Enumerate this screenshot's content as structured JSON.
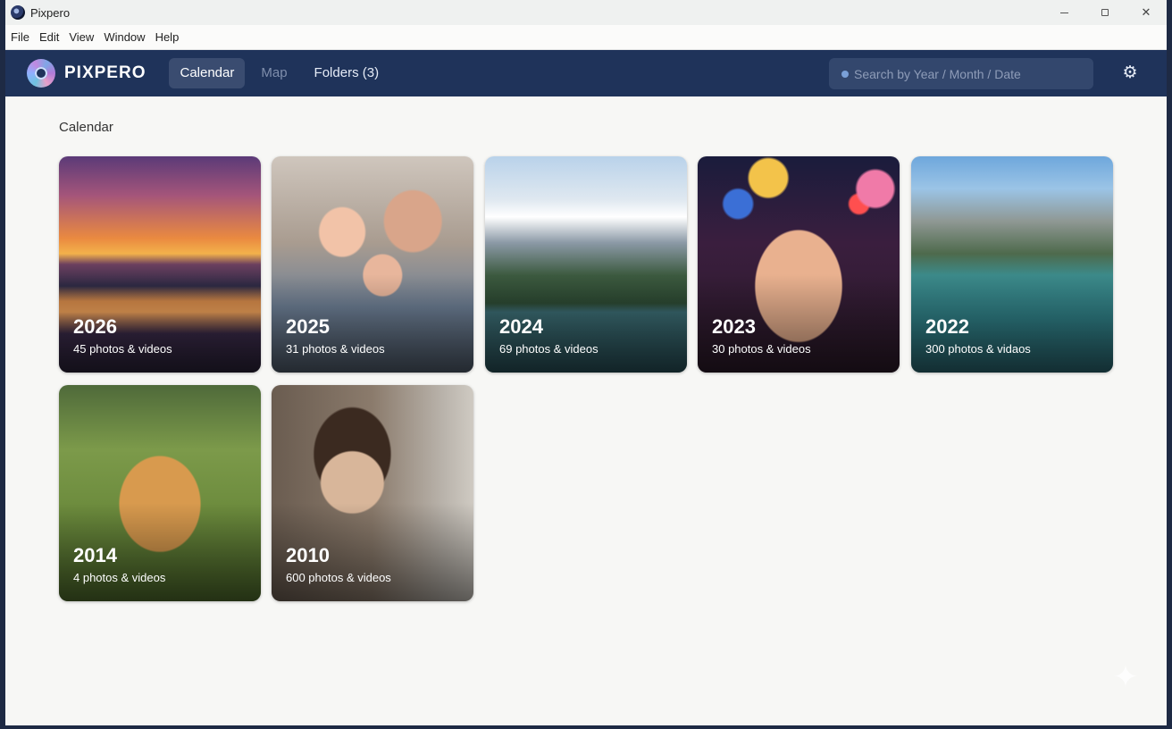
{
  "window": {
    "title": "Pixpero"
  },
  "menu": [
    "File",
    "Edit",
    "View",
    "Window",
    "Help"
  ],
  "nav": {
    "logo_text": "PIXPERO",
    "tabs": [
      {
        "label": "Calendar",
        "state": "active"
      },
      {
        "label": "Map",
        "state": "disabled"
      },
      {
        "label": "Folders (3)",
        "state": "normal"
      }
    ],
    "search_placeholder": "Search by Year / Month / Date"
  },
  "main": {
    "section_title": "Calendar",
    "cards": [
      {
        "year": "2026",
        "count": "45 photos & videos",
        "theme": "sunset-lake"
      },
      {
        "year": "2025",
        "count": "31 photos & videos",
        "theme": "family-selfie"
      },
      {
        "year": "2024",
        "count": "69 photos & videos",
        "theme": "mountain-lake"
      },
      {
        "year": "2023",
        "count": "30 photos & videos",
        "theme": "party"
      },
      {
        "year": "2022",
        "count": "300 photos & vidaos",
        "theme": "alpine-lake"
      },
      {
        "year": "2014",
        "count": "4 photos & videos",
        "theme": "golden-retriever"
      },
      {
        "year": "2010",
        "count": "600 photos & videos",
        "theme": "portrait"
      }
    ]
  },
  "colors": {
    "nav_bg": "#1f335a",
    "active_tab": "#3a4c70",
    "content_bg": "#f7f7f5"
  }
}
